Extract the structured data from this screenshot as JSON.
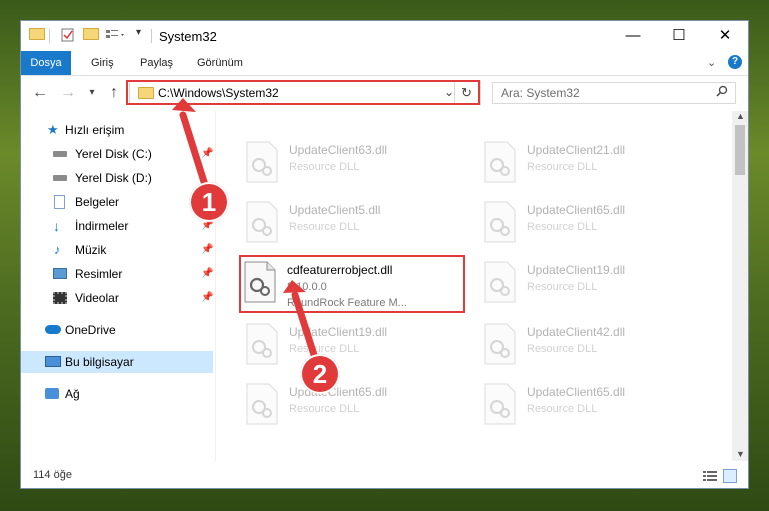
{
  "window": {
    "title": "System32"
  },
  "titlebar": {
    "minimize": "—",
    "maximize": "☐",
    "close": "✕"
  },
  "ribbon": {
    "tabs": [
      {
        "label": "Dosya"
      },
      {
        "label": "Giriş"
      },
      {
        "label": "Paylaş"
      },
      {
        "label": "Görünüm"
      }
    ],
    "help": "?"
  },
  "nav": {
    "address": "C:\\Windows\\System32",
    "search_placeholder": "Ara: System32"
  },
  "sidebar": {
    "items": [
      {
        "label": "Hızlı erişim",
        "icon": "star-icon"
      },
      {
        "label": "Yerel Disk (C:)",
        "icon": "drive-icon",
        "pinned": true
      },
      {
        "label": "Yerel Disk (D:)",
        "icon": "drive-icon",
        "pinned": false
      },
      {
        "label": "Belgeler",
        "icon": "document-icon",
        "pinned": true
      },
      {
        "label": "İndirmeler",
        "icon": "download-icon",
        "pinned": true
      },
      {
        "label": "Müzik",
        "icon": "music-icon",
        "pinned": true
      },
      {
        "label": "Resimler",
        "icon": "picture-icon",
        "pinned": true
      },
      {
        "label": "Videolar",
        "icon": "video-icon",
        "pinned": true
      },
      {
        "label": "OneDrive",
        "icon": "cloud-icon"
      },
      {
        "label": "Bu bilgisayar",
        "icon": "computer-icon",
        "selected": true
      },
      {
        "label": "Ağ",
        "icon": "network-icon"
      }
    ]
  },
  "files": [
    {
      "name": "UpdateClient63.dll",
      "type": "Resource DLL"
    },
    {
      "name": "UpdateClient21.dll",
      "type": "Resource DLL"
    },
    {
      "name": "UpdateClient5.dll",
      "type": "Resource DLL"
    },
    {
      "name": "UpdateClient65.dll",
      "type": "Resource DLL"
    },
    {
      "name": "cdfeaturerrobject.dll",
      "version": "8.10.0.0",
      "type": "RoundRock Feature M..."
    },
    {
      "name": "UpdateClient19.dll",
      "type": "Resource DLL"
    },
    {
      "name": "UpdateClient19.dll",
      "type": "Resource DLL"
    },
    {
      "name": "UpdateClient42.dll",
      "type": "Resource DLL"
    },
    {
      "name": "UpdateClient65.dll",
      "type": "Resource DLL"
    },
    {
      "name": "UpdateClient65.dll",
      "type": "Resource DLL"
    }
  ],
  "status": {
    "count": "114 öğe"
  },
  "annotations": {
    "step1": "1",
    "step2": "2"
  },
  "colors": {
    "accent": "#1979ca",
    "highlight": "#e03a3a",
    "selection": "#cce8ff"
  }
}
